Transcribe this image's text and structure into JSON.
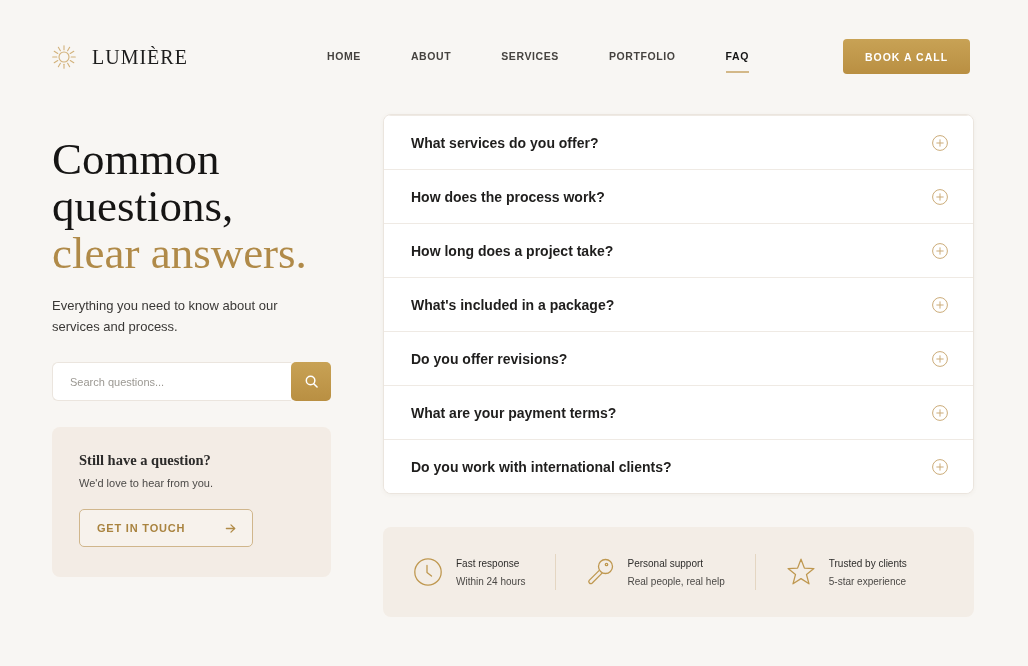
{
  "header": {
    "logo": "LUMIÈRE",
    "nav": [
      {
        "label": "HOME",
        "selected": false
      },
      {
        "label": "ABOUT",
        "selected": false
      },
      {
        "label": "SERVICES",
        "selected": false
      },
      {
        "label": "PORTFOLIO",
        "selected": false
      },
      {
        "label": "FAQ",
        "selected": true
      }
    ],
    "cta": "BOOK A CALL"
  },
  "intro": {
    "heading": "Common questions,",
    "heading_accent": "clear answers.",
    "subtitle": "Everything you need to know about our services and process.",
    "search": {
      "placeholder": "Search questions..."
    }
  },
  "contact_card": {
    "title": "Still have a question?",
    "text": "We'd love to hear from you.",
    "button": "GET IN TOUCH"
  },
  "faq": [
    {
      "question": "What services do you offer?",
      "expanded": false
    },
    {
      "question": "How does the process work?",
      "expanded": false
    },
    {
      "question": "How long does a project take?",
      "expanded": false
    },
    {
      "question": "What's included in a package?",
      "expanded": false
    },
    {
      "question": "Do you offer revisions?",
      "expanded": false
    },
    {
      "question": "What are your payment terms?",
      "expanded": false
    },
    {
      "question": "Do you work with international clients?",
      "expanded": false
    }
  ],
  "features": [
    {
      "title": "Fast response",
      "subtitle": "Within 24 hours"
    },
    {
      "title": "Personal support",
      "subtitle": "Real people, real help"
    },
    {
      "title": "Trusted by clients",
      "subtitle": "5-star experience"
    }
  ]
}
